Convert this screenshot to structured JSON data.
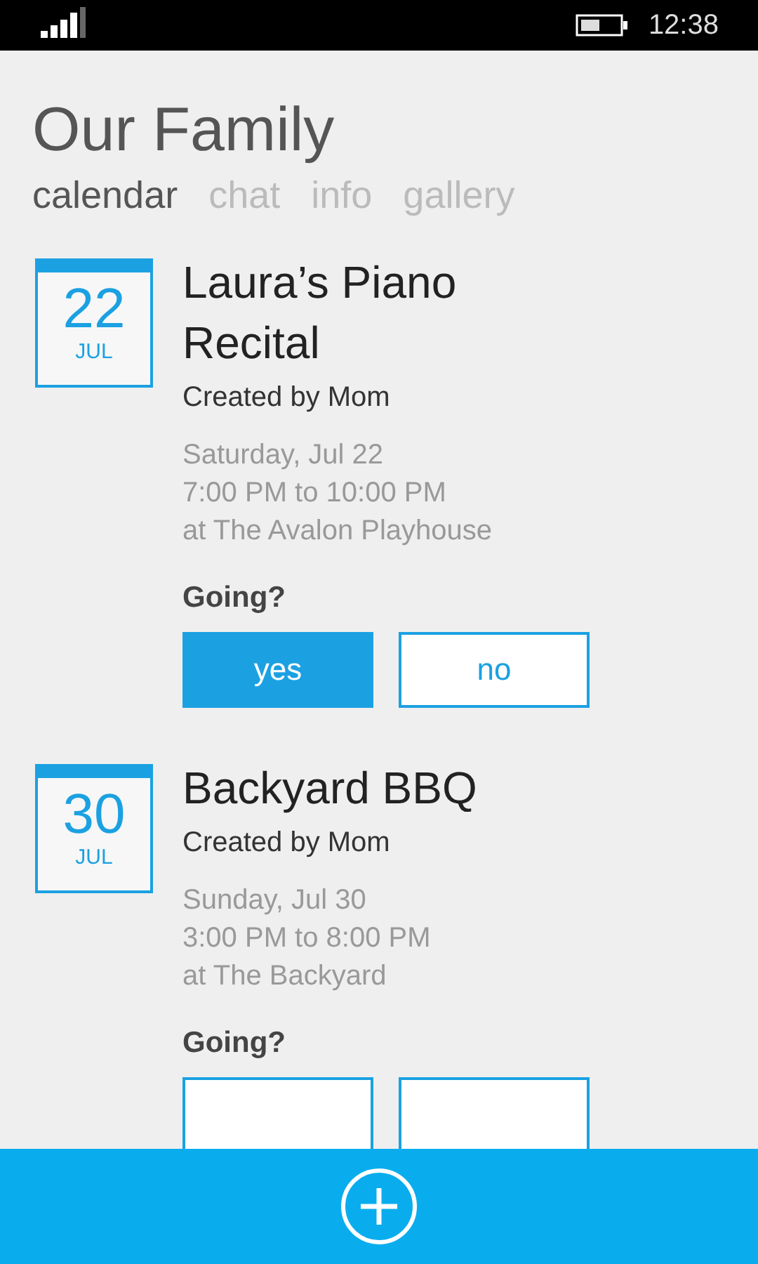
{
  "status_bar": {
    "time": "12:38"
  },
  "title": "Our Family",
  "tabs": [
    {
      "label": "calendar",
      "selected": true
    },
    {
      "label": "chat",
      "selected": false
    },
    {
      "label": "info",
      "selected": false
    },
    {
      "label": "gallery",
      "selected": false
    }
  ],
  "events": [
    {
      "day": "22",
      "month": "JUL",
      "title": "Laura’s Piano Recital",
      "creator": "Created by Mom",
      "date": "Saturday, Jul 22",
      "time": "7:00 PM to 10:00 PM",
      "place": "at The Avalon Playhouse",
      "question": "Going?",
      "options": [
        {
          "label": "yes",
          "selected": true
        },
        {
          "label": "no",
          "selected": false
        }
      ]
    },
    {
      "day": "30",
      "month": "JUL",
      "title": "Backyard BBQ",
      "creator": "Created by Mom",
      "date": "Sunday, Jul 30",
      "time": "3:00 PM to 8:00 PM",
      "place": "at The Backyard",
      "question": "Going?",
      "options": [
        {
          "selected": false
        },
        {
          "selected": false
        }
      ]
    }
  ]
}
